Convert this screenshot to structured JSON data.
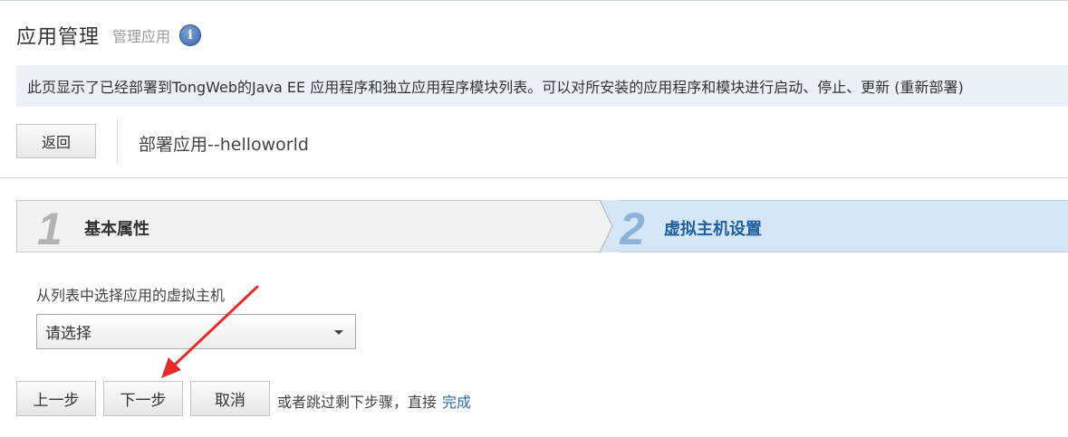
{
  "header": {
    "title": "应用管理",
    "subtitle": "管理应用",
    "info_icon": "info-icon",
    "info_glyph": "i"
  },
  "description": "此页显示了已经部署到TongWeb的Java EE 应用程序和独立应用程序模块列表。可以对所安装的应用程序和模块进行启动、停止、更新 (重新部署)",
  "toolbar": {
    "back_label": "返回",
    "deploy_title": "部署应用--helloworld"
  },
  "wizard": {
    "steps": [
      {
        "number": "1",
        "label": "基本属性",
        "active": false
      },
      {
        "number": "2",
        "label": "虚拟主机设置",
        "active": true
      }
    ]
  },
  "form": {
    "instruction": "从列表中选择应用的虚拟主机",
    "select_value": "请选择"
  },
  "actions": {
    "prev_label": "上一步",
    "next_label": "下一步",
    "cancel_label": "取消",
    "skip_text": "或者跳过剩下步骤，直接",
    "finish_label": "完成"
  },
  "colors": {
    "accent_blue": "#1f5f9e",
    "annotation_red": "#e62b2b",
    "desc_background": "#eaf0f7",
    "active_step_background": "#d5e6f6"
  }
}
